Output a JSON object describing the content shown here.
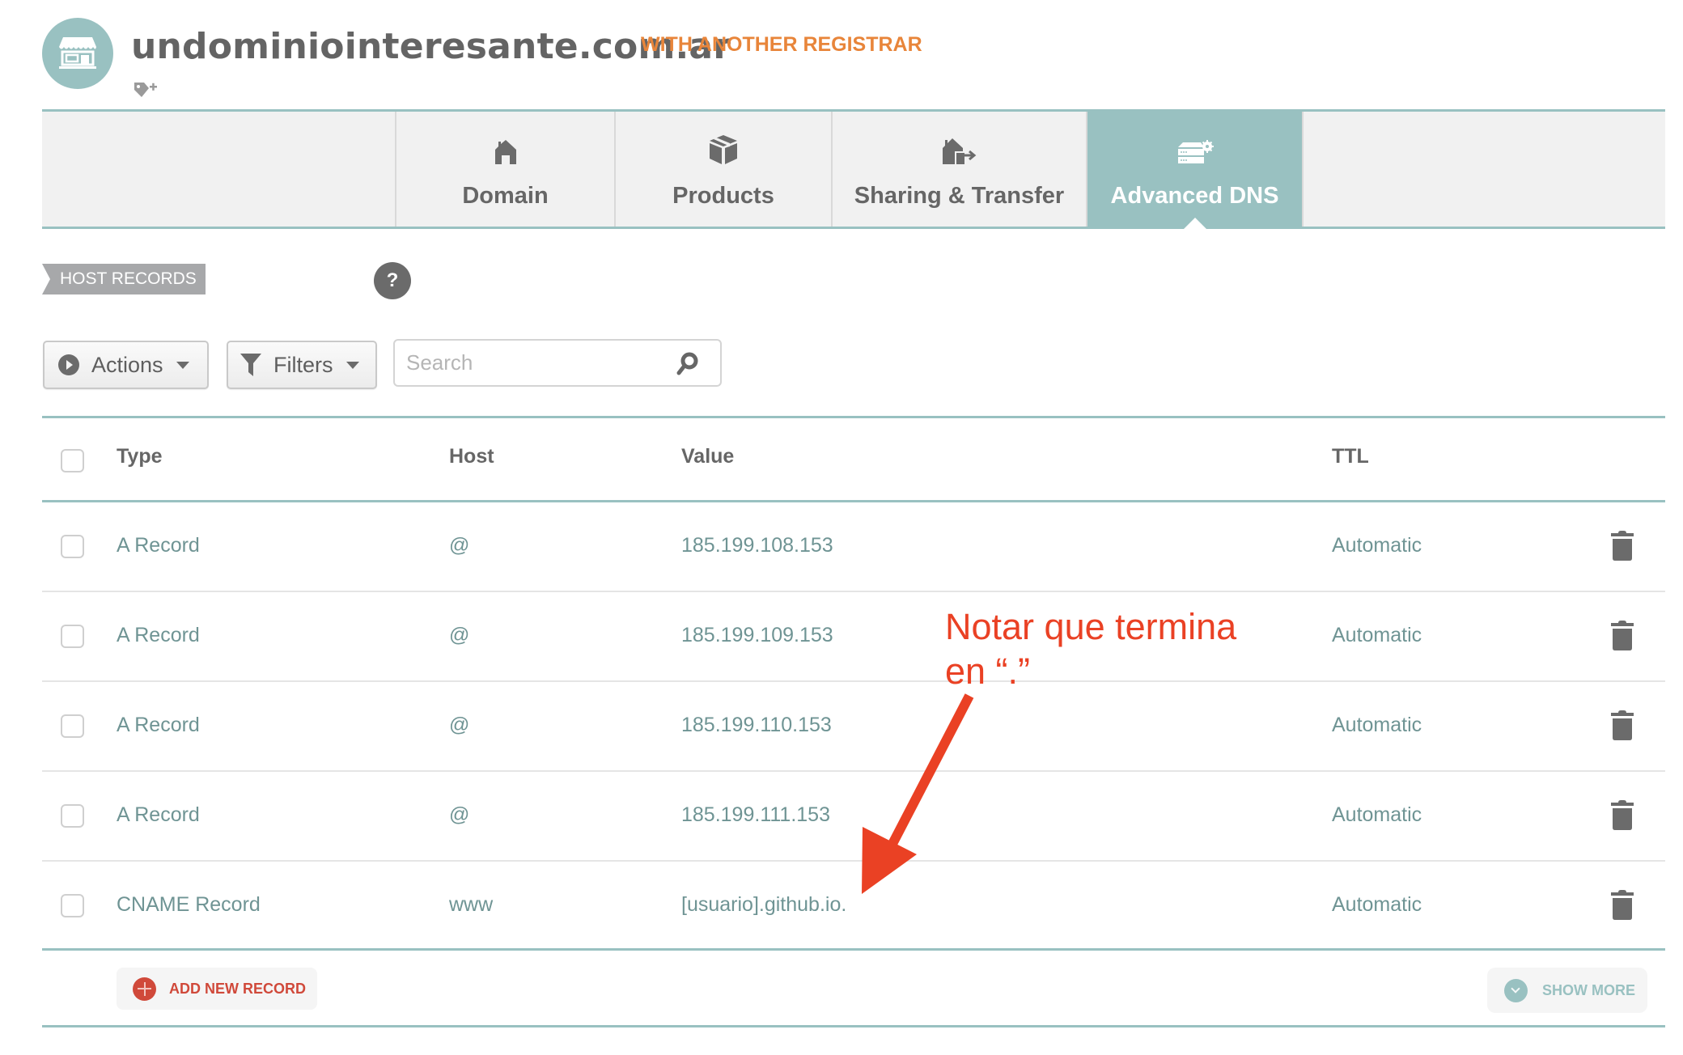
{
  "header": {
    "logo_icon": "storefront-icon",
    "domain": "undominiointeresante.com.ar",
    "registrar_badge": "WITH ANOTHER REGISTRAR",
    "tag_icon": "add-tag-icon"
  },
  "tabs": [
    {
      "label": "Domain",
      "icon": "house-icon",
      "active": false
    },
    {
      "label": "Products",
      "icon": "box-icon",
      "active": false
    },
    {
      "label": "Sharing & Transfer",
      "icon": "house-transfer-icon",
      "active": false
    },
    {
      "label": "Advanced DNS",
      "icon": "server-gear-icon",
      "active": true
    }
  ],
  "section": {
    "label": "HOST RECORDS",
    "help": "?"
  },
  "toolbar": {
    "actions_label": "Actions",
    "filters_label": "Filters",
    "search_placeholder": "Search",
    "search_value": ""
  },
  "table": {
    "columns": [
      "Type",
      "Host",
      "Value",
      "TTL"
    ],
    "rows": [
      {
        "type": "A Record",
        "host": "@",
        "value": "185.199.108.153",
        "ttl": "Automatic"
      },
      {
        "type": "A Record",
        "host": "@",
        "value": "185.199.109.153",
        "ttl": "Automatic"
      },
      {
        "type": "A Record",
        "host": "@",
        "value": "185.199.110.153",
        "ttl": "Automatic"
      },
      {
        "type": "A Record",
        "host": "@",
        "value": "185.199.111.153",
        "ttl": "Automatic"
      },
      {
        "type": "CNAME Record",
        "host": "www",
        "value": "[usuario].github.io.",
        "ttl": "Automatic"
      }
    ]
  },
  "footer": {
    "add_label": "ADD NEW RECORD",
    "more_label": "SHOW MORE"
  },
  "annotation": {
    "line1": "Notar que termina",
    "line2": "en “.”"
  },
  "colors": {
    "accent_teal": "#99c1c1",
    "registrar_orange": "#e8853a",
    "add_red": "#d0493a",
    "annotation_red": "#ea4124",
    "cell_text": "#6f9494"
  }
}
